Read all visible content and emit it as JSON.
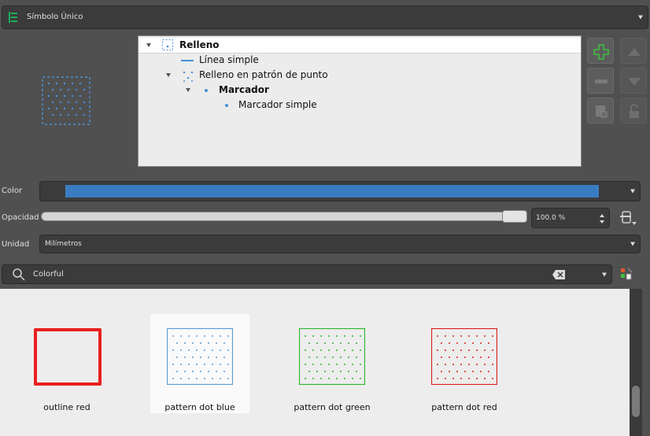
{
  "renderer": {
    "label": "Símbolo Único"
  },
  "layer_tree": {
    "items": [
      {
        "label": "Relleno",
        "bold": true
      },
      {
        "label": "Línea simple",
        "bold": false
      },
      {
        "label": "Relleno en patrón de punto",
        "bold": false
      },
      {
        "label": "Marcador",
        "bold": true
      },
      {
        "label": "Marcador simple",
        "bold": false
      }
    ]
  },
  "properties": {
    "color_label": "Color",
    "color_value": "#3a7cc2",
    "opacity_label": "Opacidad",
    "opacity_value": "100.0 %",
    "opacity_fraction": 1.0,
    "unit_label": "Unidad",
    "unit_value": "Milímetros"
  },
  "search": {
    "value": "Colorful"
  },
  "gallery": {
    "items": [
      {
        "label": "outline red",
        "color": "#e8201e"
      },
      {
        "label": "pattern dot  blue",
        "color": "#5b9bd5"
      },
      {
        "label": "pattern dot  green",
        "color": "#2db52d"
      },
      {
        "label": "pattern dot  red",
        "color": "#d9201c"
      }
    ]
  }
}
